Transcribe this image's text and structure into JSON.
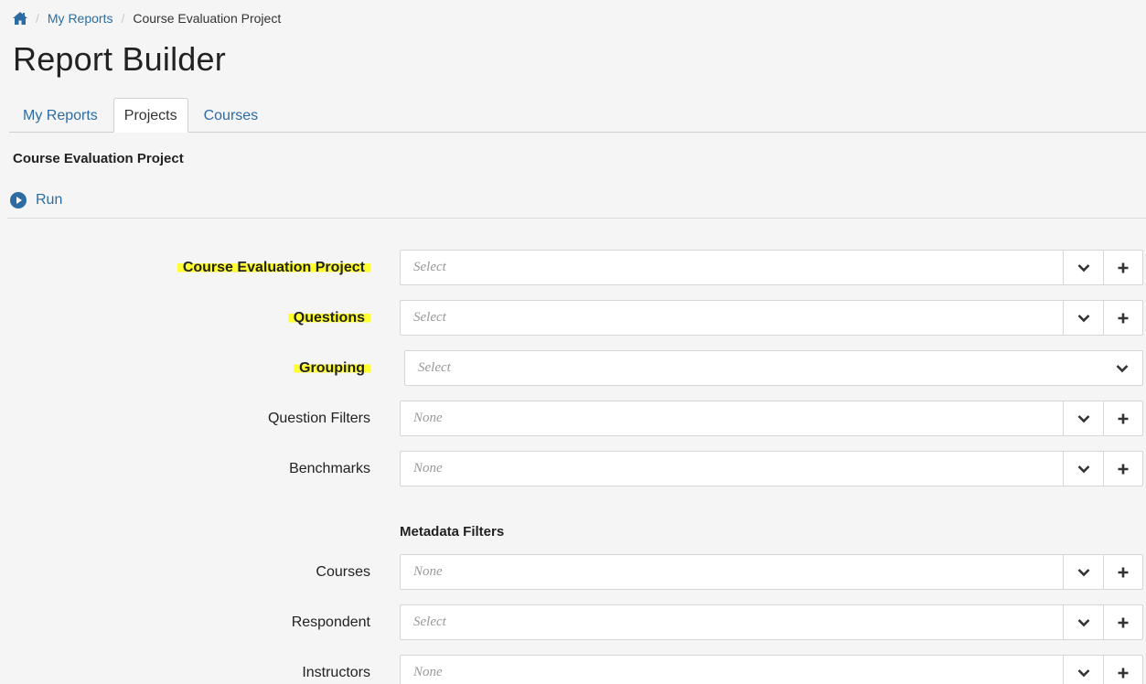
{
  "breadcrumb": {
    "home_icon": "home-icon",
    "items": [
      "My Reports",
      "Course Evaluation Project"
    ]
  },
  "page_title": "Report Builder",
  "tabs": [
    {
      "label": "My Reports",
      "active": false
    },
    {
      "label": "Projects",
      "active": true
    },
    {
      "label": "Courses",
      "active": false
    }
  ],
  "section_title": "Course Evaluation Project",
  "run_label": "Run",
  "colors": {
    "link": "#2d6ca2",
    "highlight": "#ffff33"
  },
  "fields": [
    {
      "label": "Course Evaluation Project",
      "value": "Select",
      "highlighted": true,
      "has_add": true
    },
    {
      "label": "Questions",
      "value": "Select",
      "highlighted": true,
      "has_add": true
    },
    {
      "label": "Grouping",
      "value": "Select",
      "highlighted": true,
      "has_add": false
    },
    {
      "label": "Question Filters",
      "value": "None",
      "highlighted": false,
      "has_add": true
    },
    {
      "label": "Benchmarks",
      "value": "None",
      "highlighted": false,
      "has_add": true
    }
  ],
  "metadata_title": "Metadata Filters",
  "metadata_fields": [
    {
      "label": "Courses",
      "value": "None",
      "has_add": true
    },
    {
      "label": "Respondent",
      "value": "Select",
      "has_add": true
    },
    {
      "label": "Instructors",
      "value": "None",
      "has_add": true
    }
  ]
}
